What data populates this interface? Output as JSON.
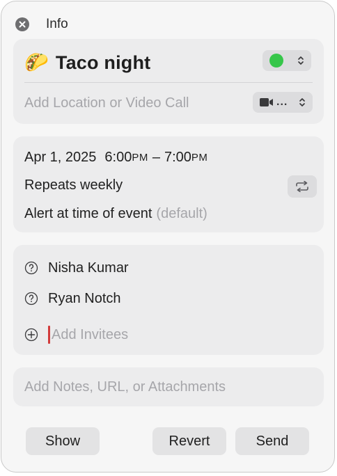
{
  "window": {
    "title": "Info"
  },
  "event": {
    "emoji": "🌮",
    "title": "Taco night",
    "calendar_color": "#36c64a",
    "location_placeholder": "Add Location or Video Call",
    "video_label": "..."
  },
  "schedule": {
    "date": "Apr 1, 2025",
    "start_time": "6:00",
    "start_period": "PM",
    "dash": "–",
    "end_time": "7:00",
    "end_period": "PM",
    "repeat": "Repeats weekly",
    "alert": "Alert at time of event",
    "alert_note": "(default)"
  },
  "invitees": {
    "people": [
      {
        "name": "Nisha Kumar",
        "status_icon": "question-circle-icon"
      },
      {
        "name": "Ryan Notch",
        "status_icon": "question-circle-icon"
      }
    ],
    "add_placeholder": "Add Invitees"
  },
  "notes": {
    "placeholder": "Add Notes, URL, or Attachments"
  },
  "buttons": {
    "show": "Show",
    "revert": "Revert",
    "send": "Send"
  }
}
